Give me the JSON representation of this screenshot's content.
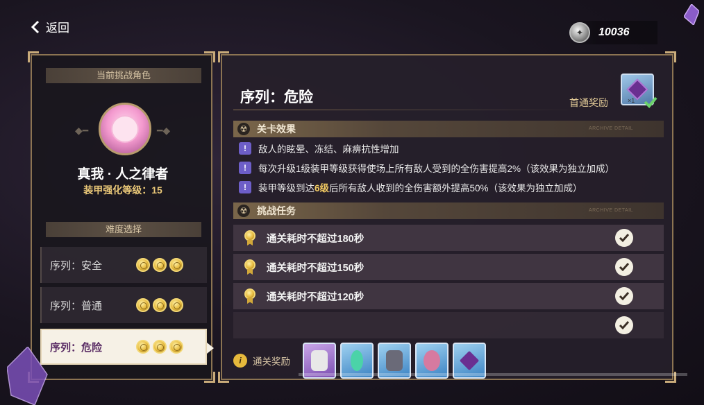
{
  "header": {
    "back_label": "返回",
    "currency_amount": "10036"
  },
  "left_panel": {
    "current_character_title": "当前挑战角色",
    "character_name": "真我 · 人之律者",
    "armor_level_label": "装甲强化等级：15",
    "difficulty_title": "难度选择",
    "difficulties": [
      {
        "label": "序列：安全",
        "medals": 3,
        "selected": false
      },
      {
        "label": "序列：普通",
        "medals": 3,
        "selected": false
      },
      {
        "label": "序列：危险",
        "medals": 3,
        "selected": true
      }
    ]
  },
  "right_panel": {
    "sequence_title": "序列：危险",
    "first_clear_reward_label": "首通奖励",
    "first_clear_reward_count": "×1",
    "stage_effects_title": "关卡效果",
    "section_tag": "ARCHIVE DETAIL",
    "effects": [
      {
        "pre": "敌人的眩晕、冻结、麻痹抗性增加",
        "hl": "",
        "post": ""
      },
      {
        "pre": "每次升级1级装甲等级获得使场上所有敌人受到的全伤害提高2%（该效果为独立加成）",
        "hl": "",
        "post": ""
      },
      {
        "pre": "装甲等级到达",
        "hl": "6级",
        "post": "后所有敌人收到的全伤害额外提高50%（该效果为独立加成）"
      }
    ],
    "challenge_tasks_title": "挑战任务",
    "tasks": [
      {
        "label": "通关耗时不超过180秒",
        "done": true
      },
      {
        "label": "通关耗时不超过150秒",
        "done": true
      },
      {
        "label": "通关耗时不超过120秒",
        "done": true
      },
      {
        "label": "",
        "done": true
      }
    ],
    "clear_reward_label": "通关奖励",
    "clear_rewards": [
      "weapon-card",
      "chain-item",
      "stigmata-item",
      "material-item",
      "crystal-item"
    ]
  },
  "colors": {
    "accent_gold": "#eac878",
    "frame": "#8c7452",
    "selected_bg": "#f6f1e6",
    "warn_purple": "#6d5ec8"
  }
}
